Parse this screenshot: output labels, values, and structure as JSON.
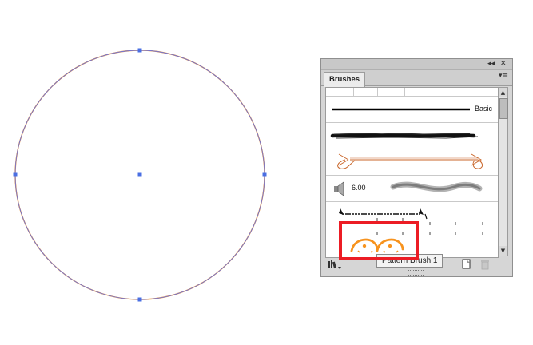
{
  "panel": {
    "tab_label": "Brushes",
    "topbar_collapse": "◂◂",
    "topbar_close": "✕",
    "tab_menu": "▾≡"
  },
  "brushes": [
    {
      "name": "Basic",
      "label": "Basic"
    },
    {
      "name": "Charcoal"
    },
    {
      "name": "Arrow"
    },
    {
      "name": "Airbrush",
      "size_label": "6.00"
    },
    {
      "name": "Border"
    },
    {
      "name": "Pattern Brush 1"
    }
  ],
  "tooltip": "Pattern Brush 1",
  "colors": {
    "path_orange": "#f7931e",
    "anchor_blue": "#4a6fe3",
    "highlight_red": "#ec1c24"
  }
}
